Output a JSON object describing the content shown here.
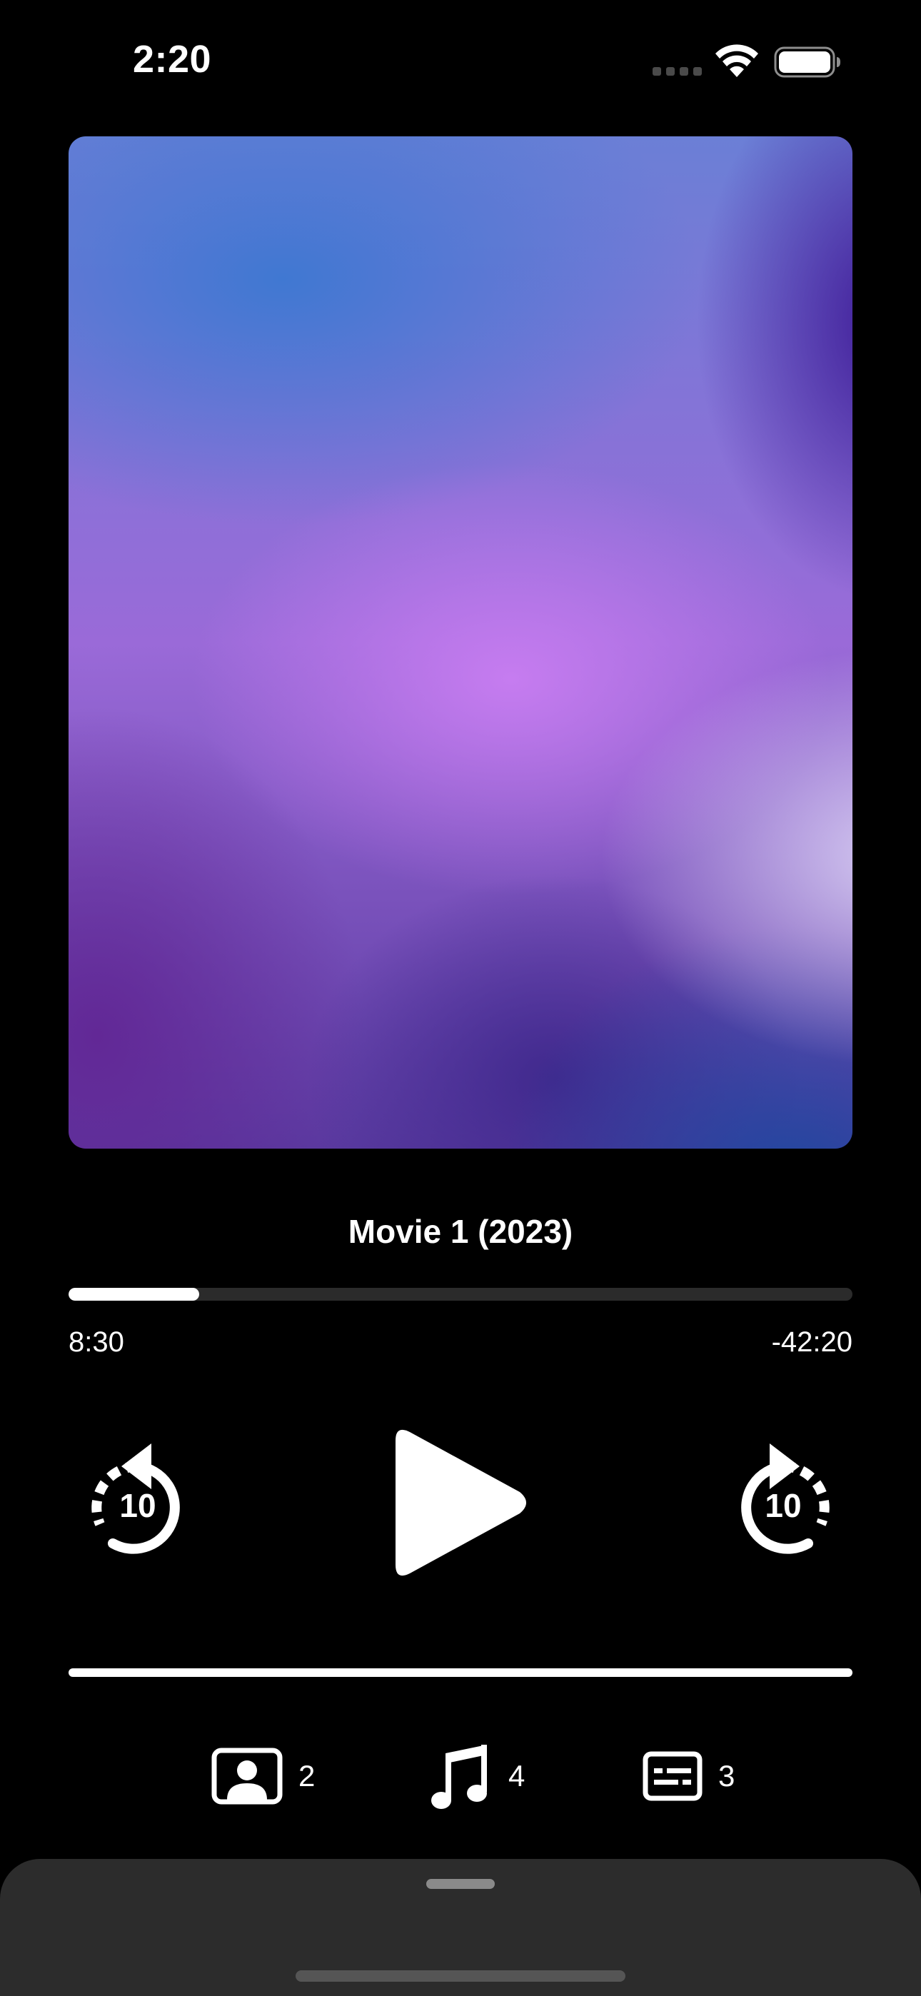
{
  "status_bar": {
    "time": "2:20",
    "signal_icon": "cellular-signal-icon",
    "wifi_icon": "wifi-icon",
    "battery_icon": "battery-icon"
  },
  "player": {
    "artwork_icon": "movie-artwork",
    "title": "Movie 1 (2023)",
    "progress_fraction": 0.167,
    "elapsed": "8:30",
    "remaining": "-42:20",
    "skip_back_label": "10",
    "skip_forward_label": "10",
    "play_icon": "play-icon",
    "volume_fraction": 1.0
  },
  "track_options": [
    {
      "icon": "video-track-icon",
      "count": "2"
    },
    {
      "icon": "audio-track-icon",
      "count": "4"
    },
    {
      "icon": "subtitles-icon",
      "count": "3"
    }
  ],
  "colors": {
    "background": "#000000",
    "foreground": "#ffffff",
    "track": "#2b2b2b",
    "sheet": "#2c2c2c"
  }
}
